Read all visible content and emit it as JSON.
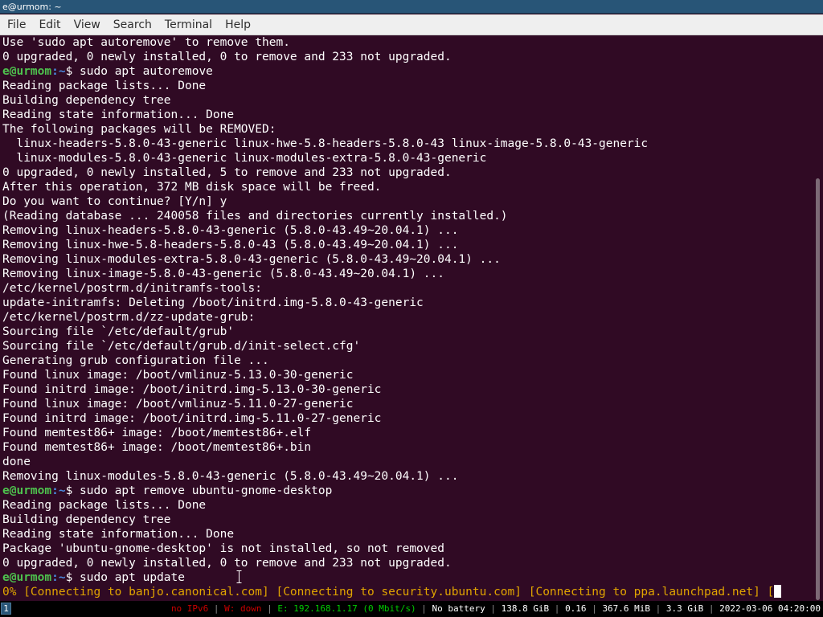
{
  "window": {
    "title": "e@urmom: ~"
  },
  "menu": {
    "items": [
      "File",
      "Edit",
      "View",
      "Search",
      "Terminal",
      "Help"
    ]
  },
  "terminal": {
    "prompt_user_host": "e@urmom",
    "prompt_path": ":~",
    "prompt_symbol": "$ ",
    "lines": [
      {
        "type": "text",
        "text": "Use 'sudo apt autoremove' to remove them."
      },
      {
        "type": "text",
        "text": "0 upgraded, 0 newly installed, 0 to remove and 233 not upgraded."
      },
      {
        "type": "prompt",
        "text": "sudo apt autoremove"
      },
      {
        "type": "text",
        "text": "Reading package lists... Done"
      },
      {
        "type": "text",
        "text": "Building dependency tree"
      },
      {
        "type": "text",
        "text": "Reading state information... Done"
      },
      {
        "type": "text",
        "text": "The following packages will be REMOVED:"
      },
      {
        "type": "text",
        "text": "  linux-headers-5.8.0-43-generic linux-hwe-5.8-headers-5.8.0-43 linux-image-5.8.0-43-generic"
      },
      {
        "type": "text",
        "text": "  linux-modules-5.8.0-43-generic linux-modules-extra-5.8.0-43-generic"
      },
      {
        "type": "text",
        "text": "0 upgraded, 0 newly installed, 5 to remove and 233 not upgraded."
      },
      {
        "type": "text",
        "text": "After this operation, 372 MB disk space will be freed."
      },
      {
        "type": "text",
        "text": "Do you want to continue? [Y/n] y"
      },
      {
        "type": "text",
        "text": "(Reading database ... 240058 files and directories currently installed.)"
      },
      {
        "type": "text",
        "text": "Removing linux-headers-5.8.0-43-generic (5.8.0-43.49~20.04.1) ..."
      },
      {
        "type": "text",
        "text": "Removing linux-hwe-5.8-headers-5.8.0-43 (5.8.0-43.49~20.04.1) ..."
      },
      {
        "type": "text",
        "text": "Removing linux-modules-extra-5.8.0-43-generic (5.8.0-43.49~20.04.1) ..."
      },
      {
        "type": "text",
        "text": "Removing linux-image-5.8.0-43-generic (5.8.0-43.49~20.04.1) ..."
      },
      {
        "type": "text",
        "text": "/etc/kernel/postrm.d/initramfs-tools:"
      },
      {
        "type": "text",
        "text": "update-initramfs: Deleting /boot/initrd.img-5.8.0-43-generic"
      },
      {
        "type": "text",
        "text": "/etc/kernel/postrm.d/zz-update-grub:"
      },
      {
        "type": "text",
        "text": "Sourcing file `/etc/default/grub'"
      },
      {
        "type": "text",
        "text": "Sourcing file `/etc/default/grub.d/init-select.cfg'"
      },
      {
        "type": "text",
        "text": "Generating grub configuration file ..."
      },
      {
        "type": "text",
        "text": "Found linux image: /boot/vmlinuz-5.13.0-30-generic"
      },
      {
        "type": "text",
        "text": "Found initrd image: /boot/initrd.img-5.13.0-30-generic"
      },
      {
        "type": "text",
        "text": "Found linux image: /boot/vmlinuz-5.11.0-27-generic"
      },
      {
        "type": "text",
        "text": "Found initrd image: /boot/initrd.img-5.11.0-27-generic"
      },
      {
        "type": "text",
        "text": "Found memtest86+ image: /boot/memtest86+.elf"
      },
      {
        "type": "text",
        "text": "Found memtest86+ image: /boot/memtest86+.bin"
      },
      {
        "type": "text",
        "text": "done"
      },
      {
        "type": "text",
        "text": "Removing linux-modules-5.8.0-43-generic (5.8.0-43.49~20.04.1) ..."
      },
      {
        "type": "prompt",
        "text": "sudo apt remove ubuntu-gnome-desktop"
      },
      {
        "type": "text",
        "text": "Reading package lists... Done"
      },
      {
        "type": "text",
        "text": "Building dependency tree"
      },
      {
        "type": "text",
        "text": "Reading state information... Done"
      },
      {
        "type": "text",
        "text": "Package 'ubuntu-gnome-desktop' is not installed, so not removed"
      },
      {
        "type": "text",
        "text": "0 upgraded, 0 newly installed, 0 to remove and 233 not upgraded."
      },
      {
        "type": "prompt",
        "text": "sudo apt update"
      },
      {
        "type": "progress",
        "text": "0% [Connecting to banjo.canonical.com] [Connecting to security.ubuntu.com] [Connecting to ppa.launchpad.net] ["
      }
    ]
  },
  "statusbar": {
    "workspace": "1",
    "ipv6": "no IPv6",
    "wireless": "W: down",
    "ethernet": "E: 192.168.1.17 (0 Mbit/s)",
    "battery": "No battery",
    "disk": "138.8 GiB",
    "load": "0.16",
    "memory_used": "367.6 MiB",
    "memory_avail": "3.3 GiB",
    "datetime": "2022-03-06 04:20:00",
    "separator": " | ",
    "colors": {
      "ipv6": "#cc0000",
      "wireless": "#cc0000",
      "ethernet": "#00cc00"
    }
  },
  "colors": {
    "terminal_bg": "#300a24",
    "prompt_user": "#4ec24e",
    "prompt_path": "#4a8ae0",
    "apt_progress": "#e0a400",
    "titlebar_bg": "#285577"
  }
}
